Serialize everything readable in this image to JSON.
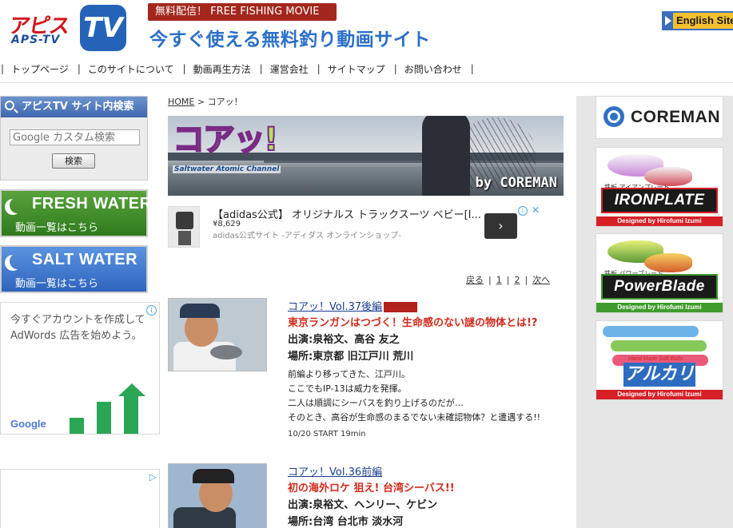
{
  "header": {
    "logo_main": "アピス",
    "logo_sub": "APS-TV",
    "logo_tv": "TV",
    "badge": "無料配信！ FREE FISHING MOVIE",
    "tagline": "今すぐ使える無料釣り動画サイト",
    "english_site": "English Site"
  },
  "nav": {
    "items": [
      {
        "label": "トップページ"
      },
      {
        "label": "このサイトについて"
      },
      {
        "label": "動画再生方法"
      },
      {
        "label": "運営会社"
      },
      {
        "label": "サイトマップ"
      },
      {
        "label": "お問い合わせ"
      }
    ],
    "separator": "|"
  },
  "sidebar": {
    "search_title": "アピスTV サイト内検索",
    "search_placeholder": "Google カスタム検索",
    "search_button": "検索",
    "fresh_title": "FRESH WATER",
    "fresh_sub": "動画一覧はこちら",
    "salt_title": "SALT WATER",
    "salt_sub": "動画一覧はこちら",
    "ad_line1": "今すぐアカウントを作成して",
    "ad_line2": "AdWords 広告を始めよう。",
    "ad_brand": "Google",
    "ad_info": "i",
    "ad_choices": "▷"
  },
  "breadcrumb": {
    "home": "HOME",
    "sep": ">",
    "current": "コアッ！"
  },
  "hero": {
    "logo": "コアッ!",
    "logo_sub": "Saltwater Atomic Channel",
    "by": "by COREMAN"
  },
  "adidas_ad": {
    "headline": "【adidas公式】 オリジナルス トラックスーツ ベビー[I...",
    "price": "¥8,629",
    "source": "adidas公式サイト -アディダス オンラインショップ-",
    "go": "›",
    "info": "i",
    "close": "✕"
  },
  "pager": {
    "back": "戻る",
    "pages": [
      "1",
      "2"
    ],
    "next": "次へ",
    "sep": "|"
  },
  "entries": [
    {
      "title": "コアッ！Vol.37後編",
      "subtitle": "東京ランガンはつづく！生命感のない謎の物体とは!?",
      "cast": "出演:泉裕文、高谷 友之",
      "place": "場所:東京都 旧江戸川 荒川",
      "desc": [
        "前編より移ってきた、江戸川。",
        "ここでもIP-13は威力を発揮。",
        "二人は順調にシーバスを釣り上げるのだが…",
        "そのとき、高谷が生命感のまるでない未確認物体？と遭遇する!!"
      ],
      "meta": "10/20 START 19min"
    },
    {
      "title": "コアッ！Vol.36前編",
      "subtitle": "初の海外ロケ 狙え! 台湾シーバス!!",
      "cast": "出演:泉裕文、ヘンリー、ケビン",
      "place": "場所:台湾 台北市 淡水河"
    }
  ],
  "sponsors": {
    "coreman": "COREMAN",
    "ironplate": "IRONPLATE",
    "ironplate_jp": "鉄板 アイアンプレート",
    "ironplate_designed": "Designed by Hirofumi Izumi",
    "powerblade": "PowerBlade",
    "powerblade_jp": "鉄板 パワーブレード",
    "powerblade_designed": "Designed by Hirofumi Izumi",
    "arukari": "アルカリ",
    "arukari_sub": "Hand Made Soft Baits",
    "arukari_designed": "Designed by Hirofumi Izumi"
  },
  "colors": {
    "accent_blue": "#2b6fc9",
    "accent_red": "#d12a1c",
    "fresh_green": "#2f7a1d",
    "salt_blue": "#2f64bd"
  }
}
